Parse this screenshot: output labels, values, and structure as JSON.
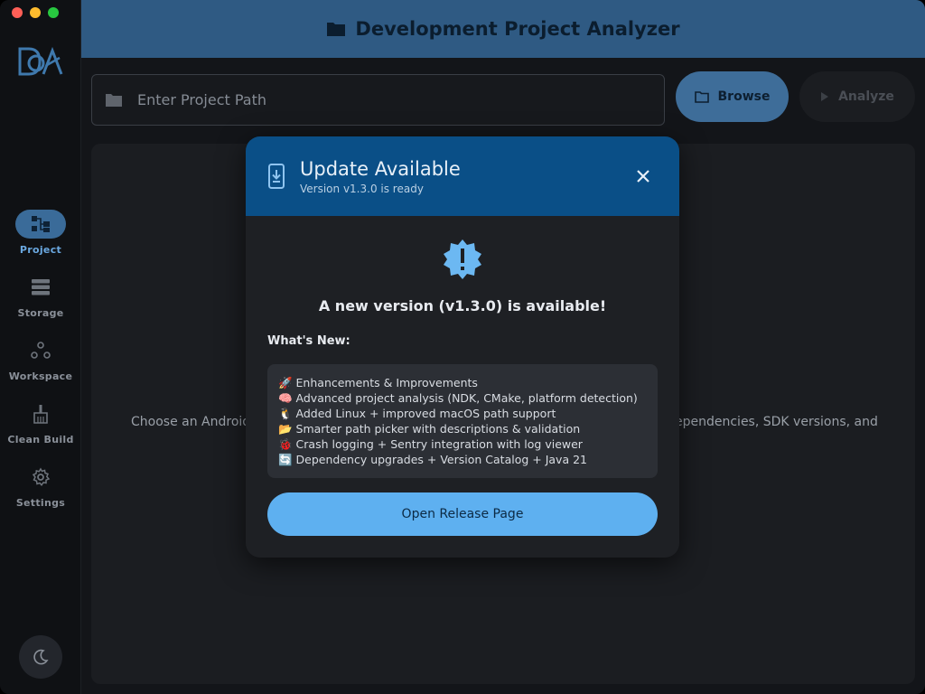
{
  "header": {
    "title": "Development Project Analyzer"
  },
  "toolbar": {
    "path_placeholder": "Enter Project Path",
    "browse_label": "Browse",
    "analyze_label": "Analyze"
  },
  "sidebar": {
    "items": [
      {
        "label": "Project",
        "icon": "hierarchy-icon",
        "active": true
      },
      {
        "label": "Storage",
        "icon": "storage-icon",
        "active": false
      },
      {
        "label": "Workspace",
        "icon": "workspace-icon",
        "active": false
      },
      {
        "label": "Clean Build",
        "icon": "broom-icon",
        "active": false
      },
      {
        "label": "Settings",
        "icon": "gear-icon",
        "active": false
      }
    ],
    "theme_toggle_icon": "moon-icon"
  },
  "background": {
    "text_left": "Choose an Android",
    "text_right": "ependencies, SDK versions, and"
  },
  "dialog": {
    "title": "Update Available",
    "subtitle": "Version v1.3.0 is ready",
    "headline": "A new version (v1.3.0) is available!",
    "whats_new_label": "What's New:",
    "notes": [
      "🚀 Enhancements & Improvements",
      "🧠 Advanced project analysis (NDK, CMake, platform detection)",
      "🐧 Added Linux + improved macOS path support",
      "📂 Smarter path picker with descriptions & validation",
      "🐞 Crash logging + Sentry integration with log viewer",
      "🔄 Dependency upgrades + Version Catalog + Java 21"
    ],
    "release_button": "Open Release Page"
  },
  "colors": {
    "header_bg": "#2f5a83",
    "dialog_header_bg": "#0a4f87",
    "accent": "#5eb0f0",
    "active_nav": "#3a6b99"
  }
}
